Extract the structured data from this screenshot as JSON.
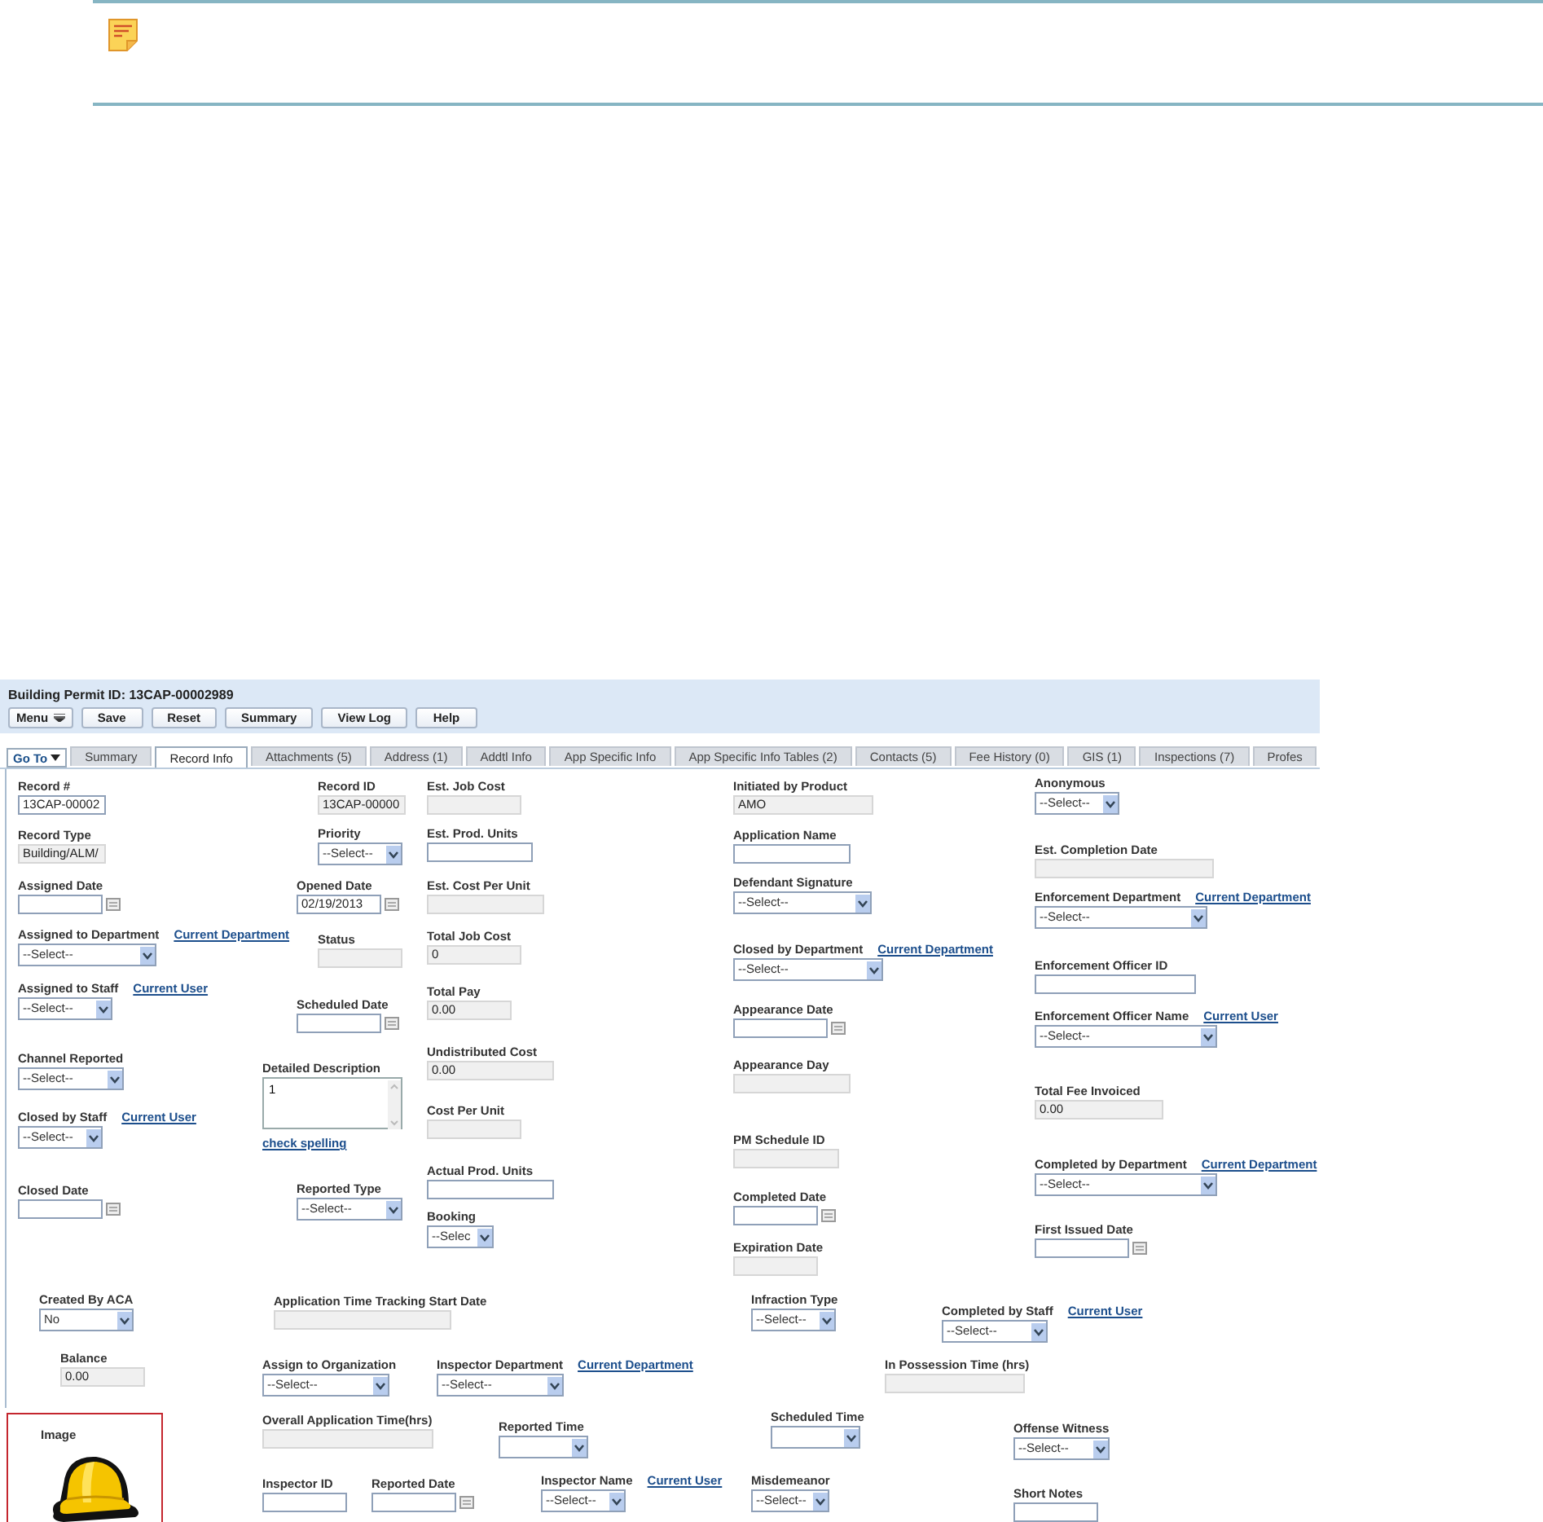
{
  "record": {
    "title": "Building Permit ID: 13CAP-00002989"
  },
  "toolbar": [
    {
      "label": "Menu",
      "kind": "menu"
    },
    {
      "label": "Save",
      "kind": "button"
    },
    {
      "label": "Reset",
      "kind": "button"
    },
    {
      "label": "Summary",
      "kind": "button"
    },
    {
      "label": "View Log",
      "kind": "button"
    },
    {
      "label": "Help",
      "kind": "button"
    }
  ],
  "go_to": {
    "label": "Go To"
  },
  "tabs": [
    {
      "label": "Summary",
      "selected": false
    },
    {
      "label": "Record Info",
      "selected": true
    },
    {
      "label": "Attachments (5)",
      "selected": false
    },
    {
      "label": "Address (1)",
      "selected": false
    },
    {
      "label": "Addtl Info",
      "selected": false
    },
    {
      "label": "App Specific Info",
      "selected": false
    },
    {
      "label": "App Specific Info Tables (2)",
      "selected": false
    },
    {
      "label": "Contacts (5)",
      "selected": false
    },
    {
      "label": "Fee History (0)",
      "selected": false
    },
    {
      "label": "GIS (1)",
      "selected": false
    },
    {
      "label": "Inspections (7)",
      "selected": false
    },
    {
      "label": "Profes",
      "selected": false
    }
  ],
  "fields": [
    {
      "label": "Record #",
      "kind": "text",
      "value": "13CAP-00002",
      "disabled": false
    },
    {
      "label": "Record Type",
      "kind": "text",
      "value": "Building/ALM/",
      "disabled": true
    },
    {
      "label": "Assigned Date",
      "kind": "date",
      "disabled": false
    },
    {
      "label": "Assigned to Department",
      "link": "Current Department",
      "kind": "select",
      "value": "--Select--",
      "disabled": false
    },
    {
      "label": "Assigned to Staff",
      "link": "Current User",
      "kind": "select",
      "value": "--Select--",
      "disabled": false
    },
    {
      "label": "Channel Reported",
      "kind": "select",
      "value": "--Select--",
      "disabled": false
    },
    {
      "label": "Closed by Staff",
      "link": "Current User",
      "kind": "select",
      "value": "--Select--",
      "disabled": false
    },
    {
      "label": "Closed Date",
      "kind": "date",
      "disabled": false
    },
    {
      "label": "Record ID",
      "kind": "text",
      "value": "13CAP-00000",
      "disabled": true
    },
    {
      "label": "Priority",
      "kind": "select",
      "value": "--Select--",
      "disabled": false
    },
    {
      "label": "Opened Date",
      "kind": "date",
      "value": "02/19/2013",
      "disabled": false
    },
    {
      "label": "Status",
      "kind": "text",
      "disabled": true
    },
    {
      "label": "Scheduled Date",
      "kind": "date",
      "disabled": false
    },
    {
      "label": "Detailed Description",
      "kind": "textarea",
      "value": "1",
      "spell_link": "check spelling",
      "disabled": false
    },
    {
      "label": "Reported Type",
      "kind": "select",
      "value": "--Select--",
      "disabled": false
    },
    {
      "label": "Est. Job Cost",
      "kind": "text",
      "disabled": true
    },
    {
      "label": "Est. Prod. Units",
      "kind": "text",
      "disabled": false
    },
    {
      "label": "Est. Cost Per Unit",
      "kind": "text",
      "disabled": true
    },
    {
      "label": "Total Job Cost",
      "kind": "text",
      "value": "0",
      "disabled": true
    },
    {
      "label": "Total Pay",
      "kind": "text",
      "value": "0.00",
      "disabled": true
    },
    {
      "label": "Undistributed Cost",
      "kind": "text",
      "value": "0.00",
      "disabled": true
    },
    {
      "label": "Cost Per Unit",
      "kind": "text",
      "disabled": true
    },
    {
      "label": "Actual Prod. Units",
      "kind": "text",
      "disabled": false
    },
    {
      "label": "Booking",
      "kind": "select",
      "value": "--Selec",
      "disabled": false
    },
    {
      "label": "Initiated by Product",
      "kind": "text",
      "value": "AMO",
      "disabled": true
    },
    {
      "label": "Application Name",
      "kind": "text",
      "disabled": false
    },
    {
      "label": "Defendant Signature",
      "kind": "select",
      "value": "--Select--",
      "disabled": false
    },
    {
      "label": "Closed by Department",
      "link": "Current Department",
      "kind": "select",
      "value": "--Select--",
      "disabled": false
    },
    {
      "label": "Appearance Date",
      "kind": "date",
      "disabled": false
    },
    {
      "label": "Appearance Day",
      "kind": "text",
      "disabled": true
    },
    {
      "label": "PM Schedule ID",
      "kind": "text",
      "disabled": true
    },
    {
      "label": "Completed Date",
      "kind": "date",
      "disabled": false
    },
    {
      "label": "Expiration Date",
      "kind": "text",
      "disabled": true
    },
    {
      "label": "Anonymous",
      "kind": "select",
      "value": "--Select--",
      "disabled": false
    },
    {
      "label": "Est. Completion Date",
      "kind": "text",
      "disabled": true
    },
    {
      "label": "Enforcement Department",
      "link": "Current Department",
      "kind": "select",
      "value": "--Select--",
      "disabled": false
    },
    {
      "label": "Enforcement Officer ID",
      "kind": "text",
      "disabled": false
    },
    {
      "label": "Enforcement Officer Name",
      "link": "Current User",
      "kind": "select",
      "value": "--Select--",
      "disabled": false
    },
    {
      "label": "Total Fee Invoiced",
      "kind": "text",
      "value": "0.00",
      "disabled": true
    },
    {
      "label": "Completed by Department",
      "link": "Current Department",
      "kind": "select",
      "value": "--Select--",
      "disabled": false
    },
    {
      "label": "First Issued Date",
      "kind": "date",
      "disabled": false
    },
    {
      "label": "Created By ACA",
      "kind": "select",
      "value": "No",
      "disabled": false
    },
    {
      "label": "Balance",
      "kind": "text",
      "value": "0.00",
      "disabled": true
    },
    {
      "label": "Application Time Tracking Start Date",
      "kind": "text",
      "disabled": true
    },
    {
      "label": "Assign to Organization",
      "kind": "select",
      "value": "--Select--",
      "disabled": false
    },
    {
      "label": "Inspector Department",
      "link": "Current Department",
      "kind": "select",
      "value": "--Select--",
      "disabled": false
    },
    {
      "label": "Overall Application Time(hrs)",
      "kind": "text",
      "disabled": true
    },
    {
      "label": "Reported Time",
      "kind": "select",
      "disabled": false
    },
    {
      "label": "Inspector ID",
      "kind": "text",
      "disabled": false
    },
    {
      "label": "Reported Date",
      "kind": "date",
      "disabled": false
    },
    {
      "label": "Inspector Name",
      "link": "Current User",
      "kind": "select",
      "value": "--Select--",
      "disabled": false
    },
    {
      "label": "Infraction Type",
      "kind": "select",
      "value": "--Select--",
      "disabled": false
    },
    {
      "label": "Completed by Staff",
      "link": "Current User",
      "kind": "select",
      "value": "--Select--",
      "disabled": false
    },
    {
      "label": "In Possession Time (hrs)",
      "kind": "text",
      "disabled": true
    },
    {
      "label": "Scheduled Time",
      "kind": "select",
      "disabled": false
    },
    {
      "label": "Offense Witness",
      "kind": "select",
      "value": "--Select--",
      "disabled": false
    },
    {
      "label": "Misdemeanor",
      "kind": "select",
      "value": "--Select--",
      "disabled": false
    },
    {
      "label": "Short Notes",
      "kind": "text",
      "disabled": false
    }
  ],
  "image": {
    "label": "Image"
  }
}
